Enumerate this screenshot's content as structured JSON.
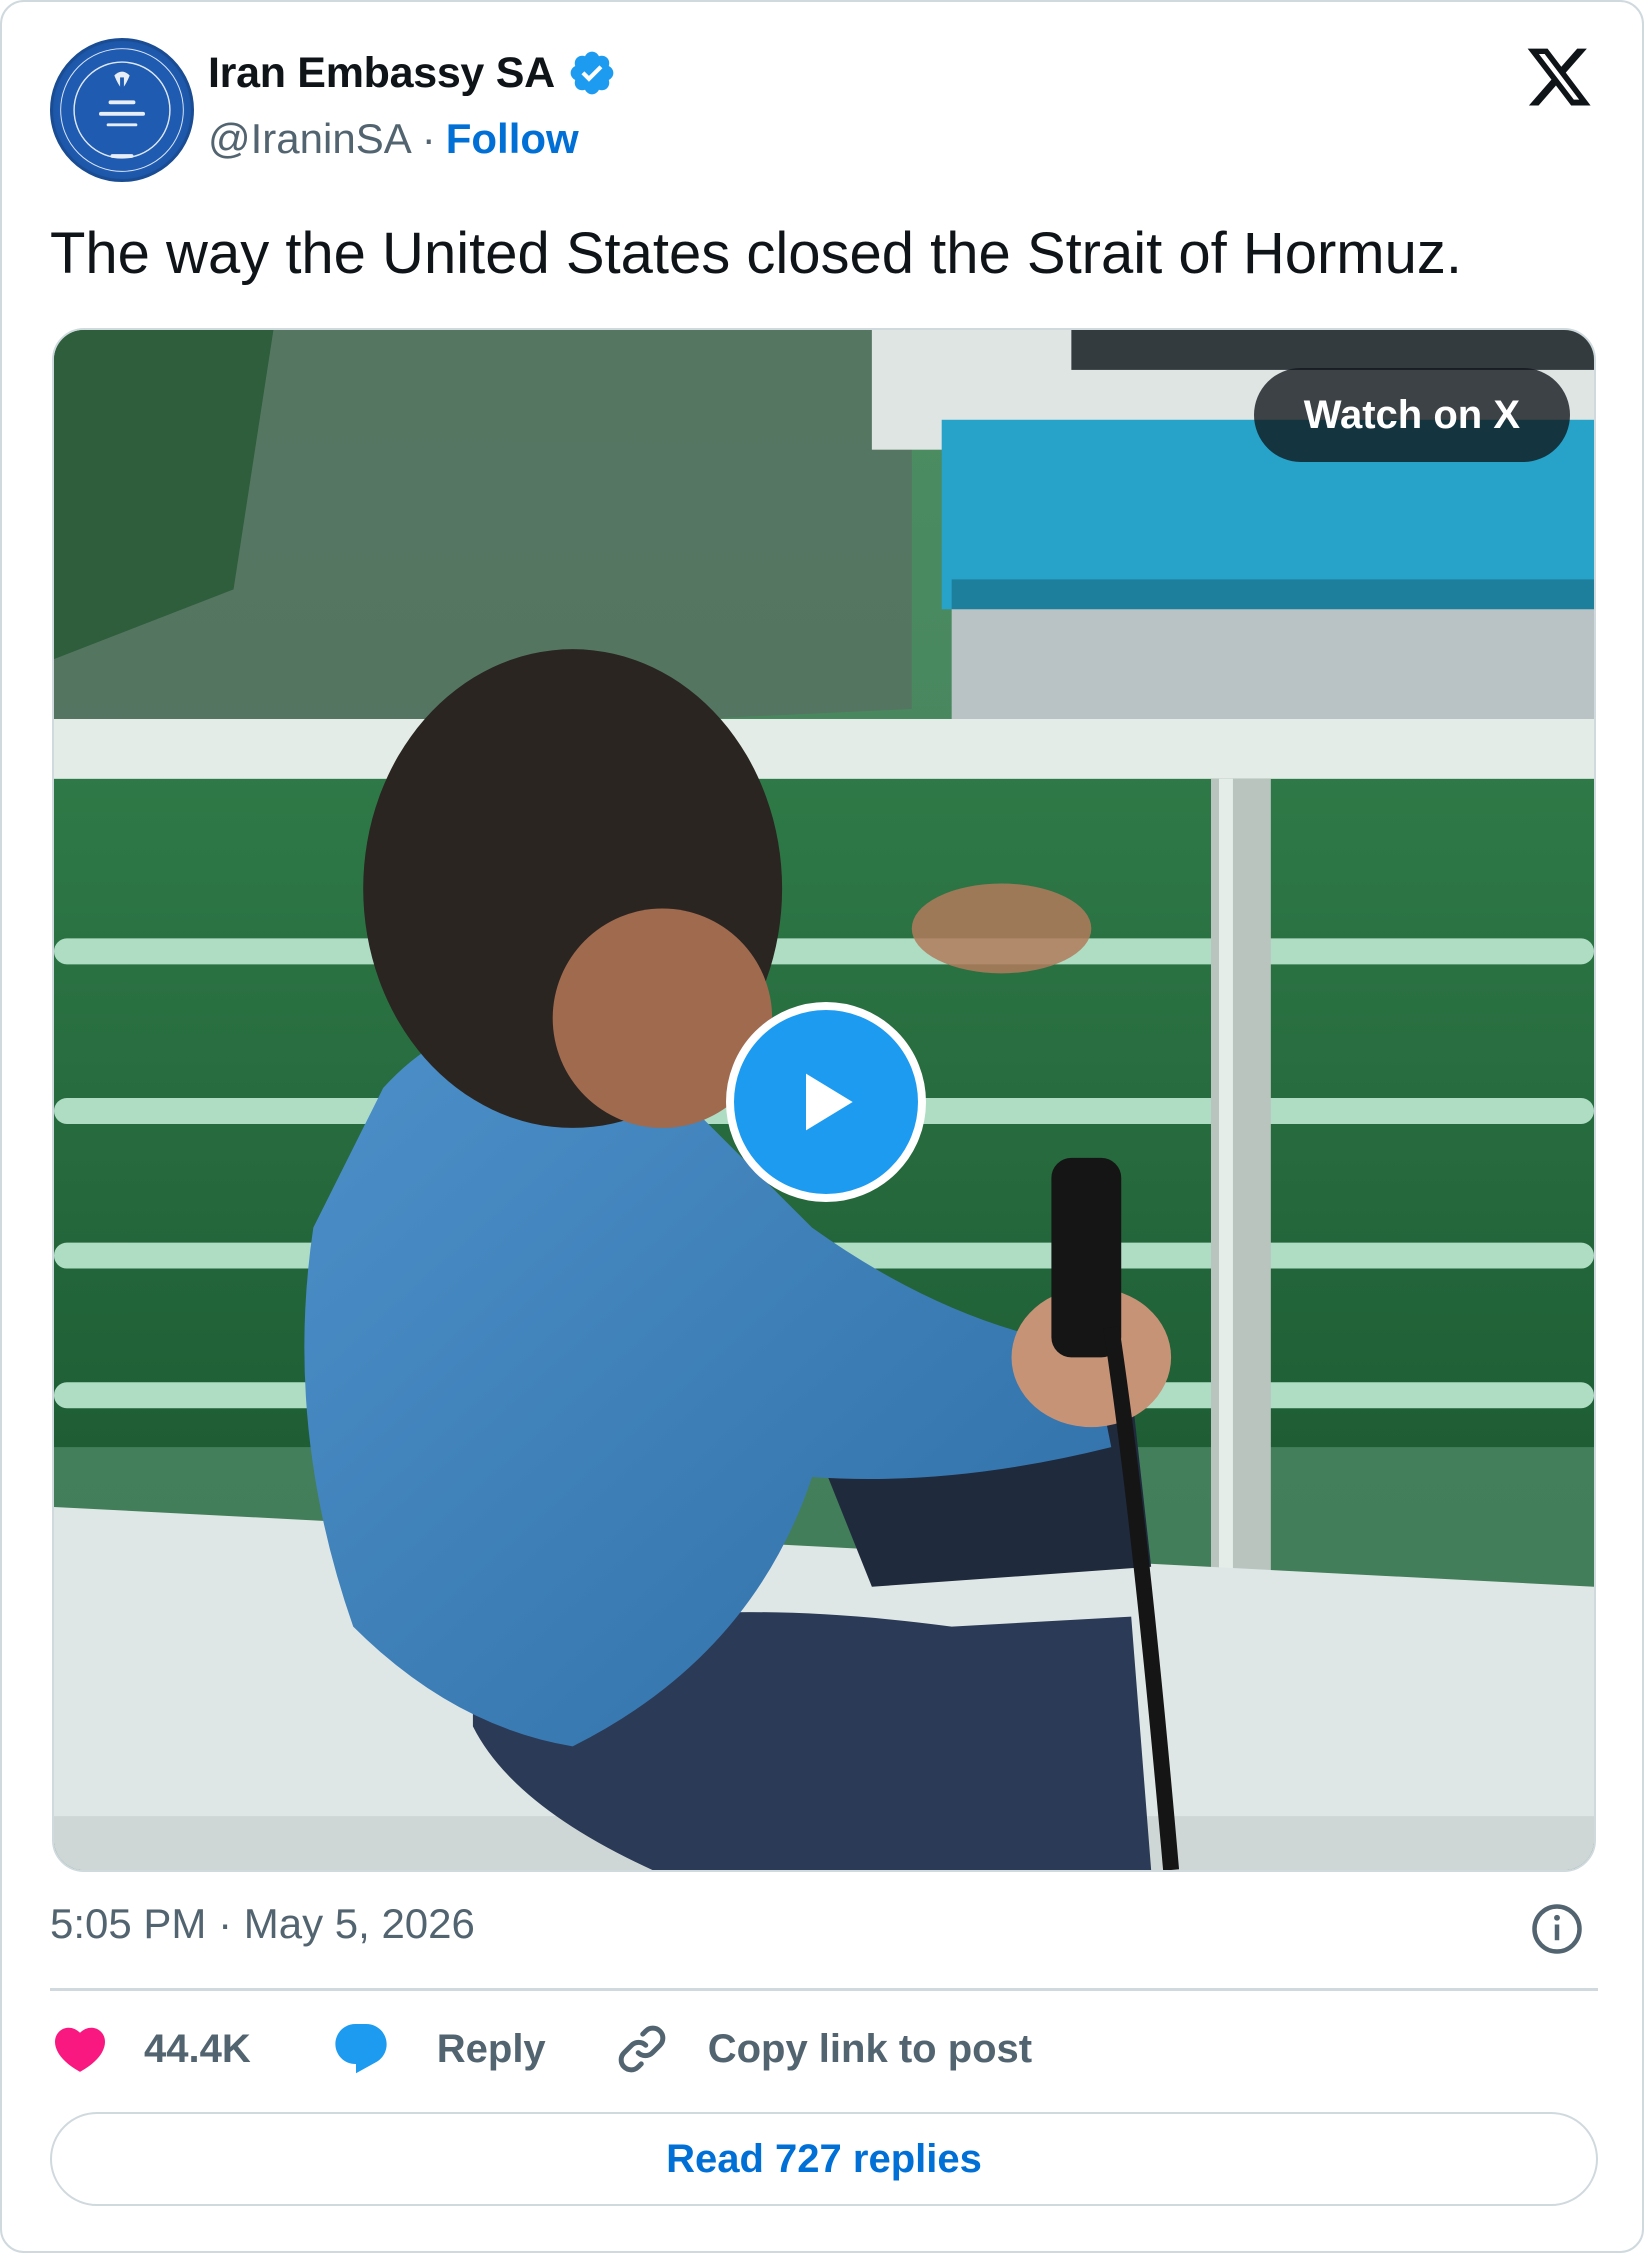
{
  "author": {
    "display_name": "Iran Embassy SA",
    "handle": "@IraninSA",
    "separator": "·",
    "follow_label": "Follow",
    "verified": true
  },
  "tweet": {
    "text": "The way the United States closed the Strait of Hormuz."
  },
  "media": {
    "watch_label": "Watch on X",
    "type": "video"
  },
  "meta": {
    "timestamp": "5:05 PM · May 5, 2026"
  },
  "actions": {
    "like_count": "44.4K",
    "reply_label": "Reply",
    "copy_label": "Copy link to post"
  },
  "footer": {
    "read_replies_label": "Read 727 replies"
  },
  "colors": {
    "brand_blue": "#1d9bf0",
    "link_blue": "#006fd6",
    "like_pink": "#f91880",
    "text_primary": "#0f1419",
    "text_secondary": "#536471",
    "border": "#cfd9de"
  },
  "icons": {
    "verified": "verified-badge-icon",
    "logo": "x-logo-icon",
    "info": "info-icon",
    "like": "heart-icon",
    "reply": "speech-bubble-icon",
    "copy": "link-icon",
    "play": "play-icon"
  }
}
